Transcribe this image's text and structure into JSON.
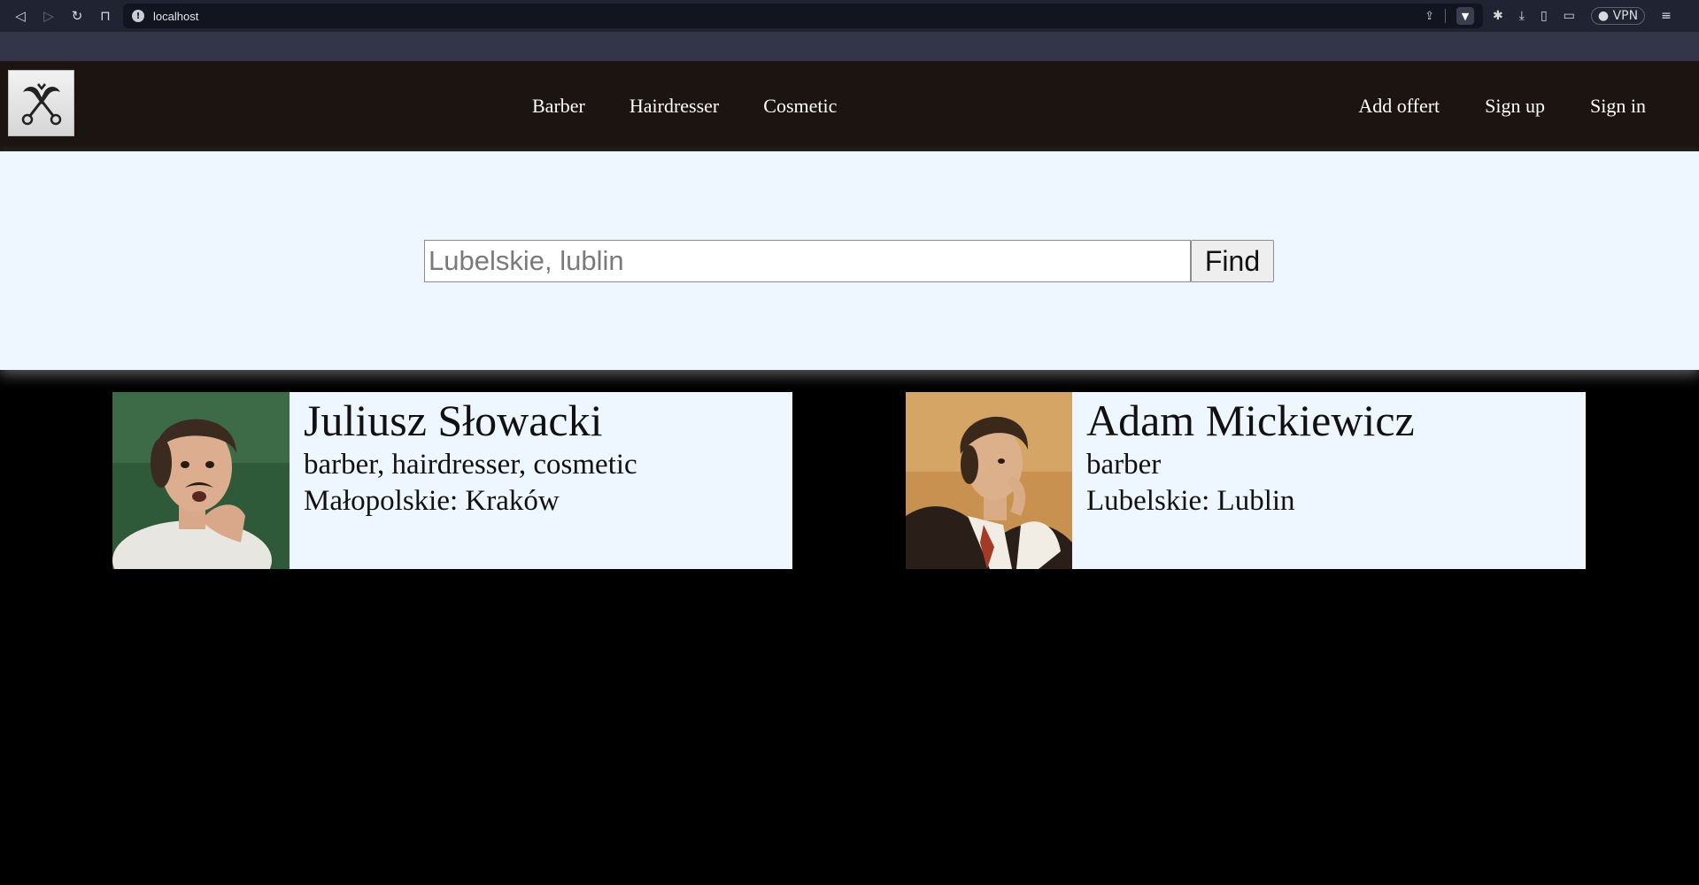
{
  "browser": {
    "url": "localhost",
    "vpn_label": "VPN",
    "icons": [
      "back-icon",
      "forward-icon",
      "reload-icon",
      "bookmark-icon",
      "info-icon",
      "share-icon",
      "brave-shield-icon",
      "extensions-icon",
      "download-icon",
      "sidebar-icon",
      "wallet-icon",
      "menu-icon"
    ]
  },
  "header": {
    "nav_center": [
      {
        "label": "Barber"
      },
      {
        "label": "Hairdresser"
      },
      {
        "label": "Cosmetic"
      }
    ],
    "nav_right": [
      {
        "label": "Add offert"
      },
      {
        "label": "Sign up"
      },
      {
        "label": "Sign in"
      }
    ]
  },
  "search": {
    "placeholder": "Lubelskie, lublin",
    "button_label": "Find"
  },
  "cards": [
    {
      "name": "Juliusz Słowacki",
      "services": "barber, hairdresser, cosmetic",
      "location": "Małopolskie: Kraków"
    },
    {
      "name": "Adam Mickiewicz",
      "services": "barber",
      "location": "Lubelskie: Lublin"
    }
  ]
}
